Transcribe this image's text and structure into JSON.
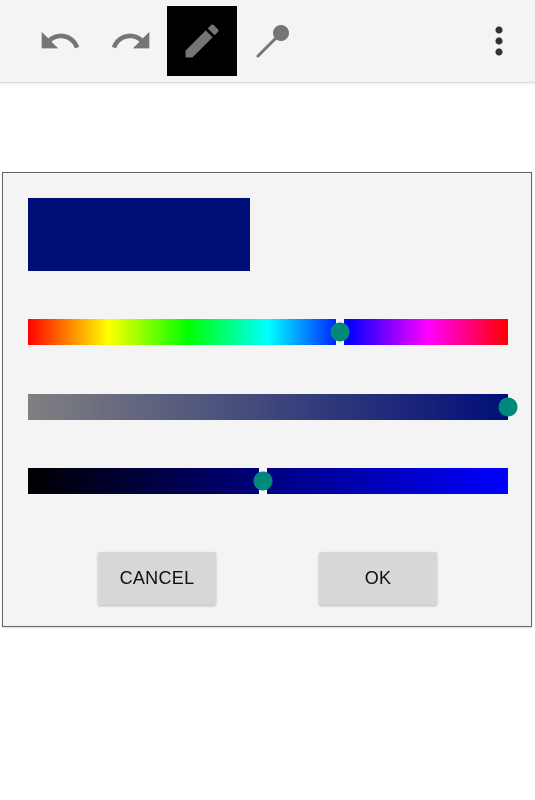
{
  "toolbar": {
    "icons": [
      "undo-icon",
      "redo-icon",
      "pencil-icon",
      "color-picker-icon",
      "more-vert-icon"
    ],
    "active_tool": "pencil",
    "icon_color": "#757575",
    "active_bg": "#000000"
  },
  "color_dialog": {
    "selected_color": "#000e78",
    "hue": 0.65,
    "saturation": 1.0,
    "value": 0.49,
    "thumb_color": "#00897b",
    "cancel_label": "CANCEL",
    "ok_label": "OK"
  }
}
